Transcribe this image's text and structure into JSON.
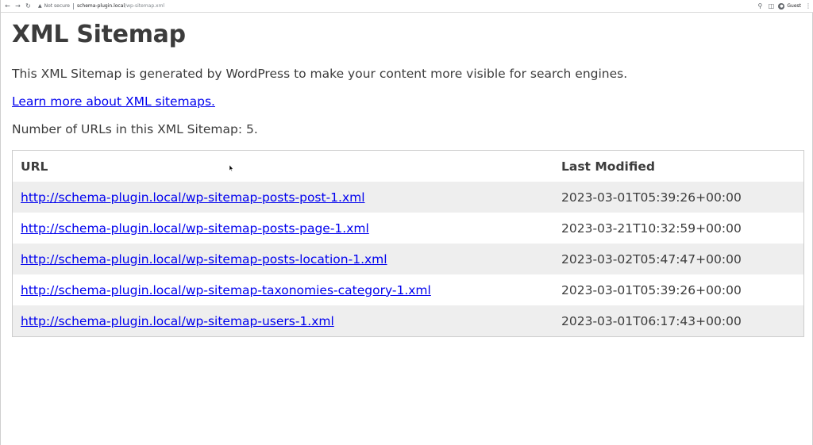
{
  "browser": {
    "not_secure": "Not secure",
    "url_host": "schema-plugin.local",
    "url_path": "/wp-sitemap.xml",
    "profile_label": "Guest"
  },
  "page": {
    "title": "XML Sitemap",
    "description": "This XML Sitemap is generated by WordPress to make your content more visible for search engines.",
    "learn_more": "Learn more about XML sitemaps.",
    "count_label": "Number of URLs in this XML Sitemap: 5."
  },
  "table": {
    "headers": {
      "url": "URL",
      "last_modified": "Last Modified"
    },
    "rows": [
      {
        "url": "http://schema-plugin.local/wp-sitemap-posts-post-1.xml",
        "last_modified": "2023-03-01T05:39:26+00:00"
      },
      {
        "url": "http://schema-plugin.local/wp-sitemap-posts-page-1.xml",
        "last_modified": "2023-03-21T10:32:59+00:00"
      },
      {
        "url": "http://schema-plugin.local/wp-sitemap-posts-location-1.xml",
        "last_modified": "2023-03-02T05:47:47+00:00"
      },
      {
        "url": "http://schema-plugin.local/wp-sitemap-taxonomies-category-1.xml",
        "last_modified": "2023-03-01T05:39:26+00:00"
      },
      {
        "url": "http://schema-plugin.local/wp-sitemap-users-1.xml",
        "last_modified": "2023-03-01T06:17:43+00:00"
      }
    ]
  },
  "colors": {
    "link": "#0000ee",
    "text": "#3c3c3c",
    "row_alt": "#eeeeee"
  }
}
